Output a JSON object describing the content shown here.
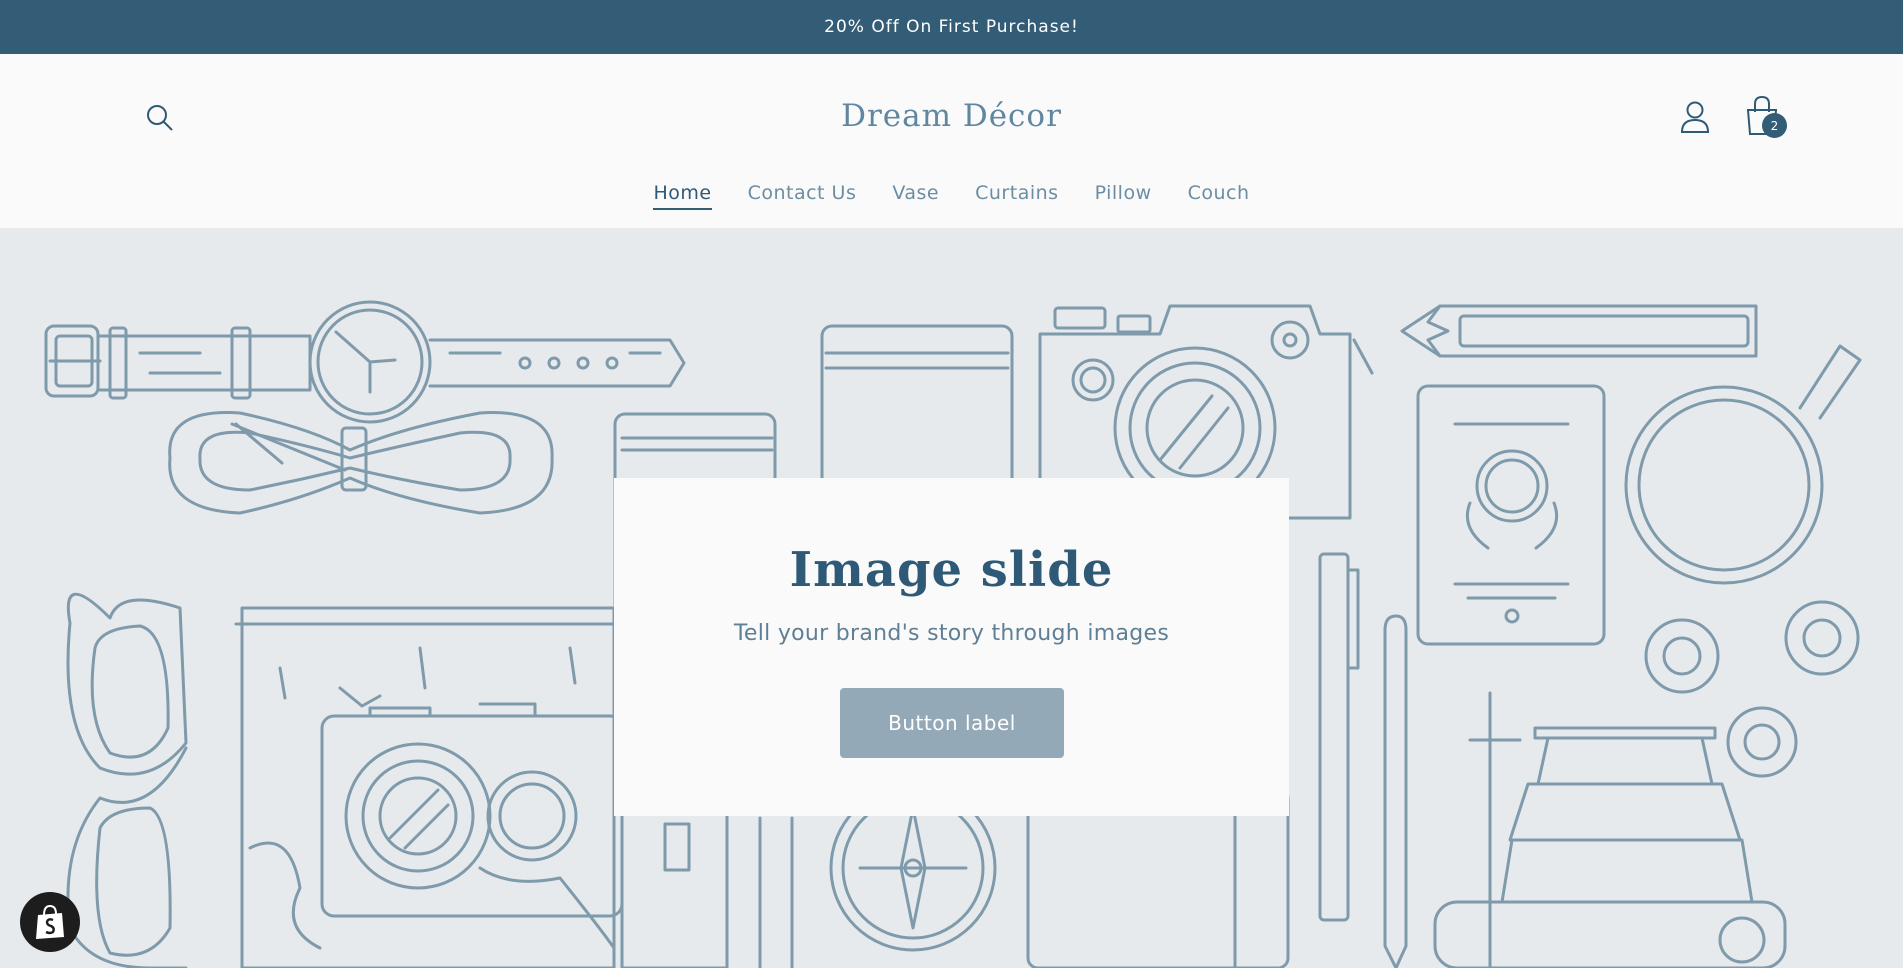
{
  "announcement": {
    "text": "20% Off On First Purchase!"
  },
  "header": {
    "brand": "Dream Décor",
    "cart_count": "2",
    "icons": {
      "search": "search-icon",
      "account": "user-icon",
      "cart": "shopping-bag-icon"
    }
  },
  "nav": {
    "items": [
      {
        "label": "Home",
        "active": true
      },
      {
        "label": "Contact Us",
        "active": false
      },
      {
        "label": "Vase",
        "active": false
      },
      {
        "label": "Curtains",
        "active": false
      },
      {
        "label": "Pillow",
        "active": false
      },
      {
        "label": "Couch",
        "active": false
      }
    ]
  },
  "hero": {
    "title": "Image slide",
    "subtitle": "Tell your brand's story through images",
    "button_label": "Button label"
  },
  "colors": {
    "announcement_bg": "#335c76",
    "accent": "#2f5a77",
    "hero_bg": "#e6eaed",
    "illustration_stroke": "#7f9aab",
    "button_bg": "#94a9b7"
  }
}
